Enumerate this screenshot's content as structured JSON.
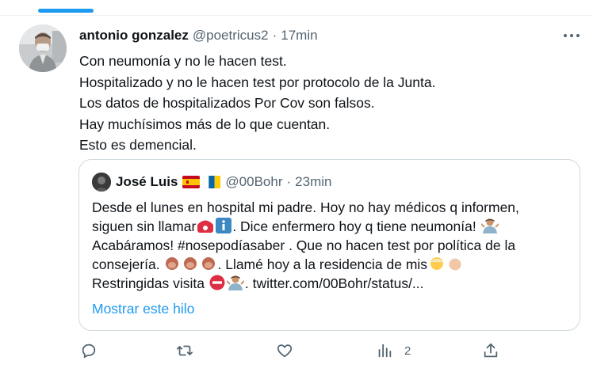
{
  "tweet": {
    "author_name": "antonio gonzalez",
    "author_handle": "@poetricus2",
    "separator": "·",
    "time": "17min",
    "lines": [
      "Con neumonía y no le hacen test.",
      "Hospitalizado y no le hacen test por protocolo de la Junta.",
      "Los datos de hospitalizados Por Cov son falsos.",
      "Hay muchísimos más de lo que cuentan.",
      "Esto es demencial."
    ]
  },
  "quote": {
    "author_name": "José Luis",
    "author_handle": "@00Bohr",
    "separator": "·",
    "time": "23min",
    "line1": "Desde el lunes en hospital mi padre. Hoy no hay médicos q informen,",
    "line2_a": "siguen sin llamar",
    "line2_b": ". Dice enfermero hoy q tiene neumonía!",
    "line3": "Acabáramos! #nosepodíasaber . Que no hacen test por política de la",
    "line4_a": "consejería.",
    "line4_b": ". Llamé hoy a la residencia de mis",
    "line5_a": "Restringidas visita",
    "line5_b": ". twitter.com/00Bohr/status/...",
    "show_thread": "Mostrar este hilo"
  },
  "actions": {
    "views_count": "2"
  },
  "icons": {
    "more": "more-icon",
    "reply": "reply-icon",
    "retweet": "retweet-icon",
    "like": "like-icon",
    "views": "views-icon",
    "share": "share-icon"
  },
  "colors": {
    "accent": "#1d9bf0",
    "text": "#0f1419",
    "muted": "#536471",
    "border": "#cfd9de"
  }
}
